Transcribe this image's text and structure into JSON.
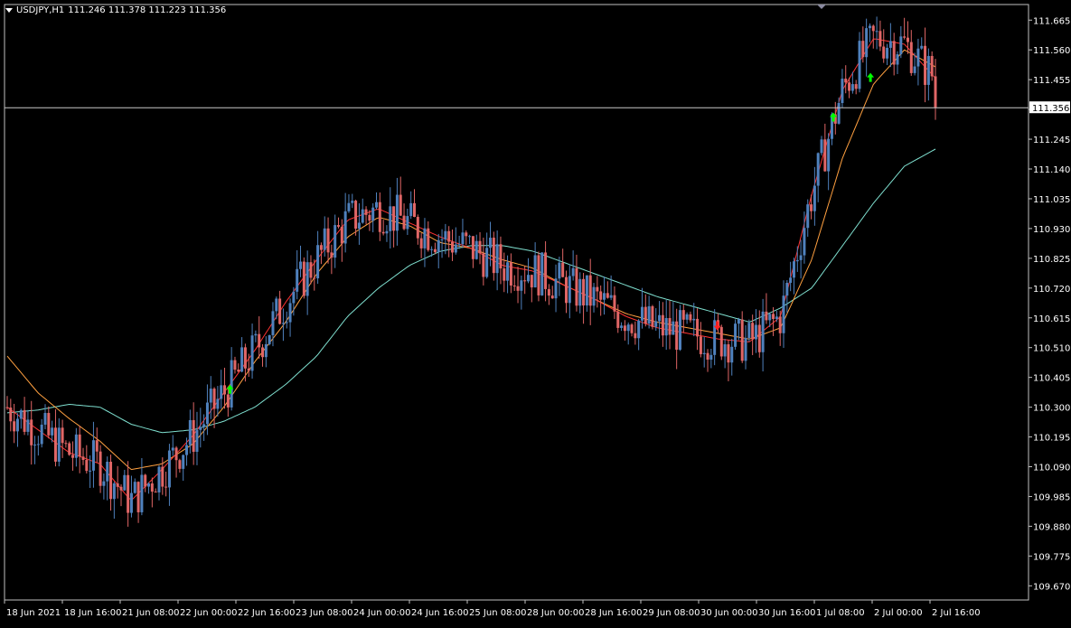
{
  "header": {
    "symbol": "USDJPY,H1",
    "ohlc": "111.246 111.378 111.223 111.356"
  },
  "chart_data": {
    "type": "candlestick",
    "symbol": "USDJPY",
    "timeframe": "H1",
    "ylim": [
      109.62,
      111.72
    ],
    "y_ticks": [
      111.665,
      111.56,
      111.455,
      111.35,
      111.245,
      111.14,
      111.035,
      110.93,
      110.825,
      110.72,
      110.615,
      110.51,
      110.405,
      110.3,
      110.195,
      110.09,
      109.985,
      109.88,
      109.775,
      109.67
    ],
    "x_tick_labels": [
      "18 Jun 2021",
      "18 Jun 16:00",
      "21 Jun 08:00",
      "22 Jun 00:00",
      "22 Jun 16:00",
      "23 Jun 08:00",
      "24 Jun 00:00",
      "24 Jun 16:00",
      "25 Jun 08:00",
      "28 Jun 00:00",
      "28 Jun 16:00",
      "29 Jun 08:00",
      "30 Jun 00:00",
      "30 Jun 16:00",
      "1 Jul 08:00",
      "2 Jul 00:00",
      "2 Jul 16:00"
    ],
    "current_price": 111.356,
    "current_price_label": "111.356",
    "grid": false,
    "colors": {
      "bull": "#4f81bd",
      "bear": "#e06666",
      "ma_fast": "#ff3333",
      "ma_mid": "#ffa040",
      "ma_slow": "#7fe0d0",
      "buy_arrow": "#00ff00",
      "sell_arrow": "#ff2020",
      "price_line": "#c8c8c8"
    },
    "ma_fast_keypoints": [
      110.3,
      110.22,
      110.14,
      110.1,
      109.97,
      110.08,
      110.2,
      110.35,
      110.5,
      110.67,
      110.82,
      110.96,
      111.0,
      110.95,
      110.9,
      110.86,
      110.8,
      110.78,
      110.73,
      110.68,
      110.62,
      110.58,
      110.56,
      110.54,
      110.53,
      110.62,
      111.05,
      111.42,
      111.6,
      111.58,
      111.46
    ],
    "ma_mid_keypoints": [
      110.48,
      110.35,
      110.26,
      110.18,
      110.08,
      110.1,
      110.17,
      110.3,
      110.46,
      110.6,
      110.77,
      110.9,
      110.97,
      110.94,
      110.88,
      110.86,
      110.82,
      110.79,
      110.73,
      110.68,
      110.63,
      110.6,
      110.58,
      110.56,
      110.54,
      110.58,
      110.82,
      111.18,
      111.44,
      111.56,
      111.5
    ],
    "ma_slow_keypoints": [
      110.28,
      110.29,
      110.31,
      110.3,
      110.24,
      110.21,
      110.22,
      110.25,
      110.3,
      110.38,
      110.48,
      110.62,
      110.72,
      110.8,
      110.85,
      110.87,
      110.87,
      110.85,
      110.81,
      110.77,
      110.73,
      110.69,
      110.66,
      110.63,
      110.6,
      110.65,
      110.72,
      110.87,
      111.02,
      111.15,
      111.21
    ],
    "signals": [
      {
        "type": "buy",
        "time_index": 0.24,
        "price": 110.36
      },
      {
        "type": "sell",
        "time_index": 0.765,
        "price": 110.59
      },
      {
        "type": "buy",
        "time_index": 0.89,
        "price": 111.32
      },
      {
        "type": "buy",
        "time_index": 0.93,
        "price": 111.46
      }
    ]
  }
}
